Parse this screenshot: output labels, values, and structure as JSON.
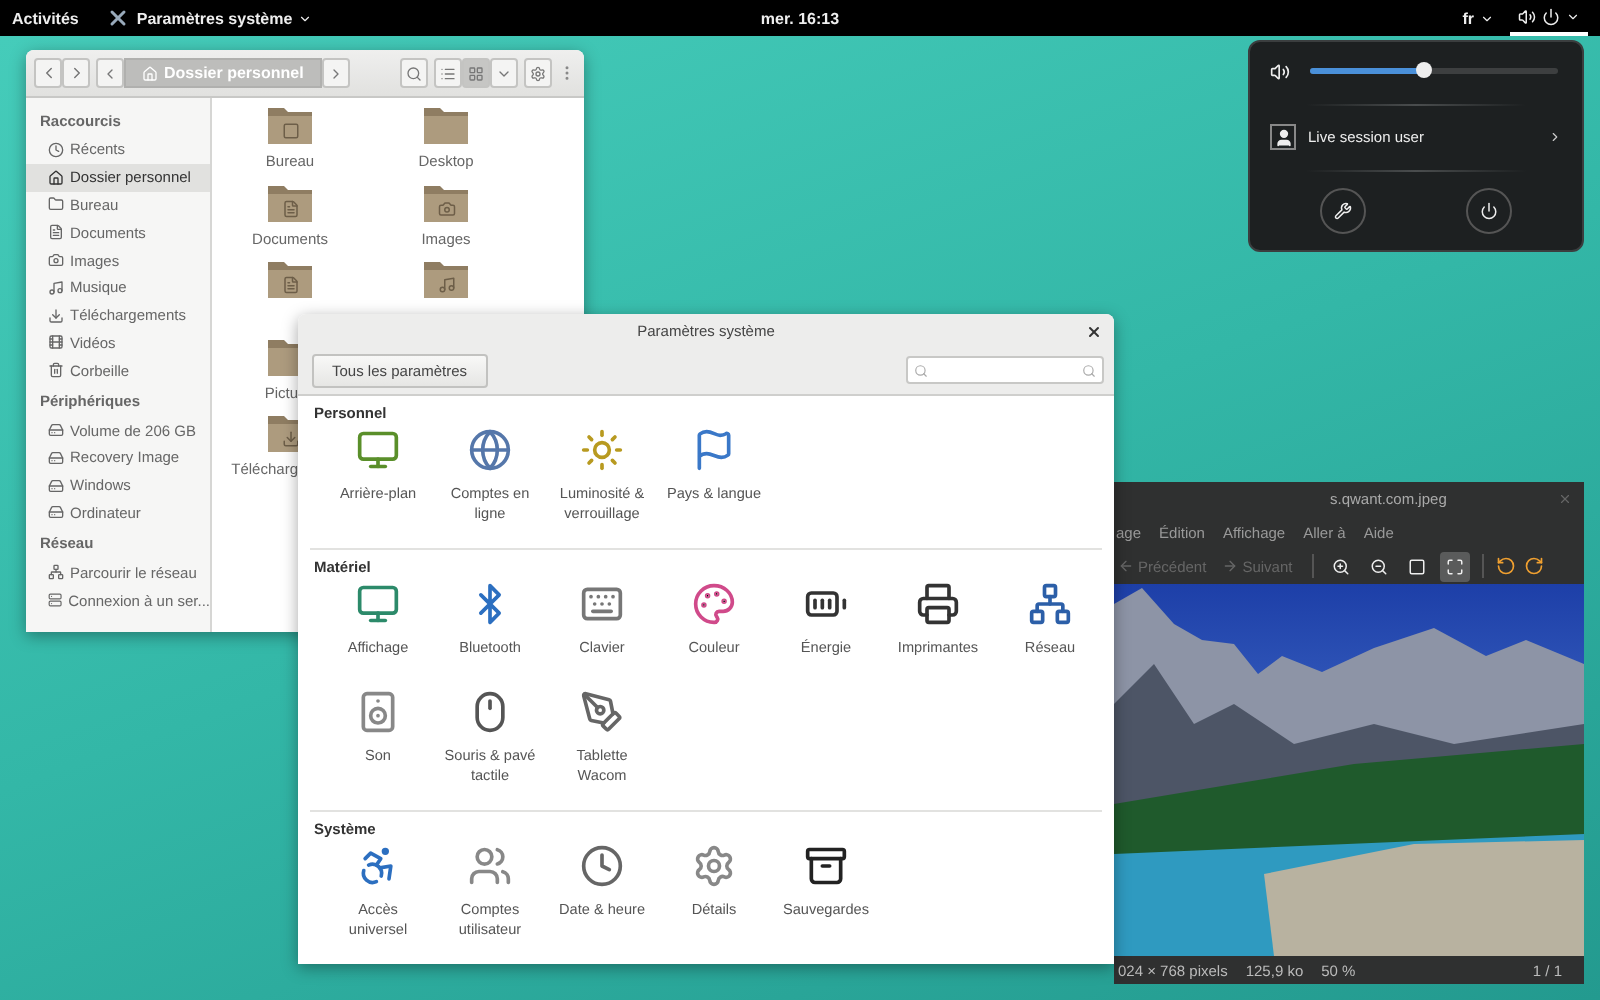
{
  "top_bar": {
    "activities": "Activités",
    "app_menu": "Paramètres système",
    "clock": "mer. 16:13",
    "language": "fr"
  },
  "system_menu": {
    "volume": {
      "level": 0.46
    },
    "user": "Live session user"
  },
  "file_manager": {
    "path": "Dossier personnel",
    "sidebar": [
      {
        "heading": "Raccourcis",
        "items": [
          {
            "label": "Récents",
            "kind": "recent",
            "selected": false
          },
          {
            "label": "Dossier personnel",
            "kind": "home",
            "selected": true
          },
          {
            "label": "Bureau",
            "kind": "folder",
            "selected": false
          },
          {
            "label": "Documents",
            "kind": "document",
            "selected": false
          },
          {
            "label": "Images",
            "kind": "camera",
            "selected": false
          },
          {
            "label": "Musique",
            "kind": "music",
            "selected": false
          },
          {
            "label": "Téléchargements",
            "kind": "download",
            "selected": false
          },
          {
            "label": "Vidéos",
            "kind": "video",
            "selected": false
          },
          {
            "label": "Corbeille",
            "kind": "trash",
            "selected": false
          }
        ]
      },
      {
        "heading": "Périphériques",
        "items": [
          {
            "label": "Volume de 206 GB",
            "kind": "drive",
            "selected": false
          },
          {
            "label": "Recovery Image",
            "kind": "drive",
            "selected": false
          },
          {
            "label": "Windows",
            "kind": "drive",
            "selected": false
          },
          {
            "label": "Ordinateur",
            "kind": "drive",
            "selected": false
          }
        ]
      },
      {
        "heading": "Réseau",
        "items": [
          {
            "label": "Parcourir le réseau",
            "kind": "network",
            "selected": false
          },
          {
            "label": "Connexion à un ser...",
            "kind": "server",
            "selected": false
          }
        ]
      }
    ],
    "files": [
      {
        "label": "Bureau",
        "kind": "desktop"
      },
      {
        "label": "Desktop",
        "kind": "plain"
      },
      {
        "label": "Documents",
        "kind": "documents"
      },
      {
        "label": "Images",
        "kind": "pictures"
      },
      {
        "kind": "templates"
      },
      {
        "kind": "music"
      },
      {
        "label": "Pictu",
        "kind": "plain",
        "cut": true
      },
      {
        "kind": "none"
      },
      {
        "label": "Télécharg",
        "kind": "downloads",
        "cut": true
      }
    ]
  },
  "image_viewer": {
    "title": "s.qwant.com.jpeg",
    "menus": [
      "age",
      "Édition",
      "Affichage",
      "Aller à",
      "Aide"
    ],
    "nav": [
      {
        "label": "Précédent",
        "kind": "previous",
        "disabled": true
      },
      {
        "label": "Suivant",
        "kind": "next",
        "disabled": true
      }
    ],
    "tools": [
      {
        "kind": "zoom-in",
        "selected": false
      },
      {
        "kind": "zoom-out",
        "selected": false
      },
      {
        "kind": "normal",
        "selected": false
      },
      {
        "kind": "fit",
        "selected": true
      }
    ],
    "status": {
      "size": "024 × 768 pixels",
      "file_size": "125,9 ko",
      "zoom": "50 %",
      "page": "1 / 1"
    }
  },
  "settings": {
    "title": "Paramètres système",
    "all_button": "Tous les paramètres",
    "sections": [
      {
        "heading": "Personnel",
        "items": [
          {
            "label": "Arrière-plan",
            "kind": "wallpaper"
          },
          {
            "label": "Comptes en ligne",
            "kind": "accounts"
          },
          {
            "label": "Luminosité & verrouillage",
            "kind": "brightness"
          },
          {
            "label": "Pays & langue",
            "kind": "region"
          }
        ]
      },
      {
        "heading": "Matériel",
        "items": [
          {
            "label": "Affichage",
            "kind": "display"
          },
          {
            "label": "Bluetooth",
            "kind": "bluetooth"
          },
          {
            "label": "Clavier",
            "kind": "keyboard"
          },
          {
            "label": "Couleur",
            "kind": "color"
          },
          {
            "label": "Énergie",
            "kind": "power"
          },
          {
            "label": "Imprimantes",
            "kind": "printers"
          },
          {
            "label": "Réseau",
            "kind": "network"
          },
          {
            "label": "Son",
            "kind": "sound"
          },
          {
            "label": "Souris & pavé tactile",
            "kind": "mouse"
          },
          {
            "label": "Tablette Wacom",
            "kind": "tablet"
          }
        ]
      },
      {
        "heading": "Système",
        "items": [
          {
            "label": "Accès universel",
            "kind": "accessibility"
          },
          {
            "label": "Comptes utilisateur",
            "kind": "users"
          },
          {
            "label": "Date & heure",
            "kind": "datetime"
          },
          {
            "label": "Détails",
            "kind": "details"
          },
          {
            "label": "Sauvegardes",
            "kind": "backups"
          }
        ]
      }
    ]
  }
}
